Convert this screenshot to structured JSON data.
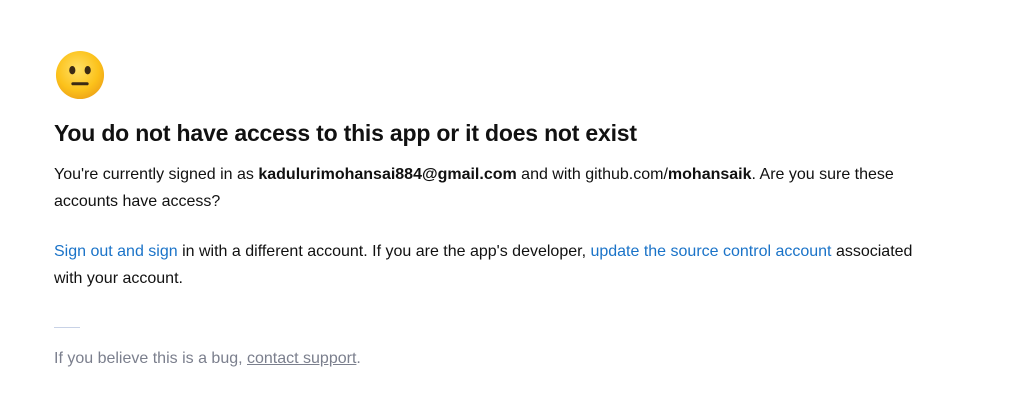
{
  "icon": "neutral-face-emoji-icon",
  "heading": "You do not have access to this app or it does not exist",
  "signed_in": {
    "prefix": "You're currently signed in as ",
    "email": "kadulurimohansai884@gmail.com",
    "middle": " and with github.com/",
    "github_user": "mohansaik",
    "suffix": ". Are you sure these accounts have access?"
  },
  "actions": {
    "sign_out_link": "Sign out and sign",
    "middle": " in with a different account. If you are the app's developer, ",
    "update_link": "update the source control account",
    "suffix": " associated with your account."
  },
  "footer": {
    "prefix": "If you believe this is a bug, ",
    "support_link": "contact support",
    "suffix": "."
  },
  "colors": {
    "link": "#1a73c8",
    "muted": "#7b7f8d",
    "divider": "#c8d2e6",
    "emoji": "#fcc21b"
  }
}
